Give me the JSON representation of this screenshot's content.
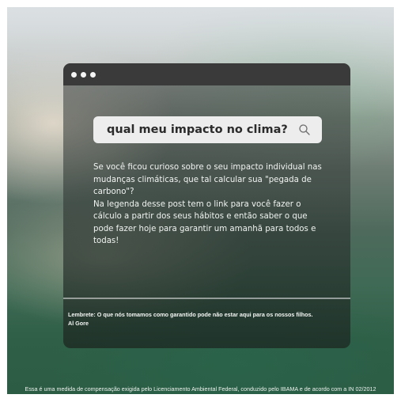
{
  "window": {
    "dots": [
      "dot",
      "dot",
      "dot"
    ]
  },
  "search": {
    "query": "qual meu impacto no clima?",
    "icon": "search-icon"
  },
  "body": {
    "paragraph_1": "Se você ficou curioso sobre o seu impacto individual nas mudanças climáticas, que tal calcular sua \"pegada de carbono\"?",
    "paragraph_2": "Na legenda desse post tem o link para você fazer o cálculo a partir dos seus hábitos e então saber o que pode fazer hoje para garantir um amanhã para todos e todas!"
  },
  "footer": {
    "quote": "Lembrete: O que nós tomamos como garantido pode não estar aqui para os nossos filhos.",
    "author": "Al Gore"
  },
  "caption": "Essa é uma medida de compensação exigida pelo Licenciamento Ambiental Federal, conduzido pelo IBAMA e de acordo com a IN 02/2012",
  "colors": {
    "titlebar": "#3a3a3a",
    "search_bg": "#ededee",
    "text_light": "#f1f4f2"
  }
}
